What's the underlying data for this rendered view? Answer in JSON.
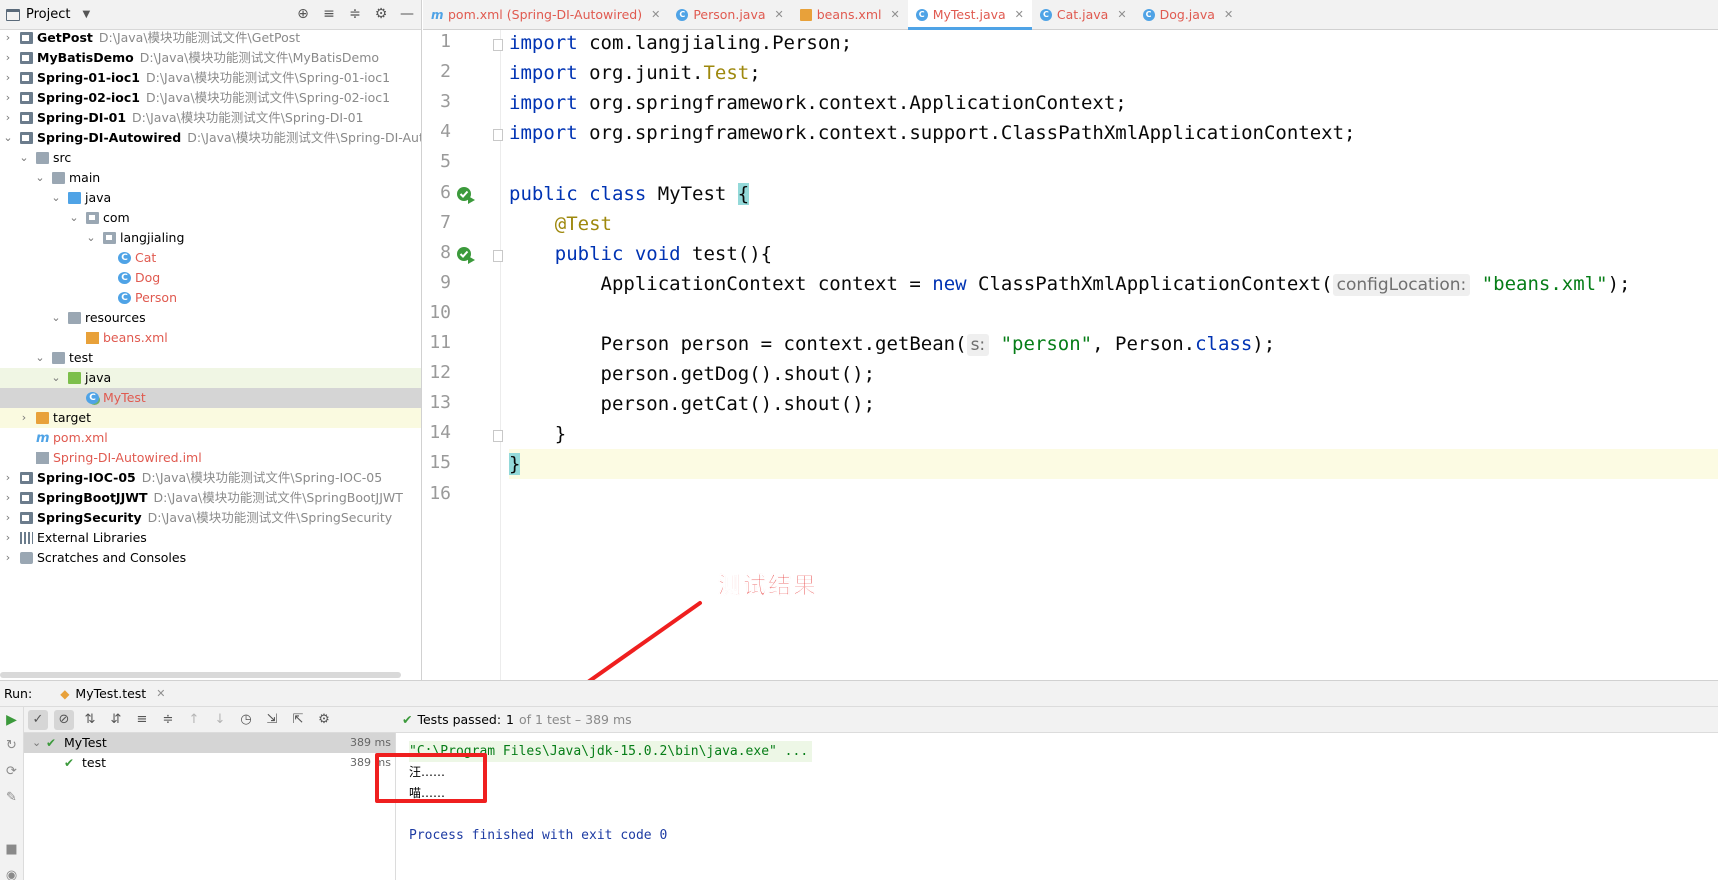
{
  "project_panel": {
    "title": "Project",
    "tree": [
      {
        "label": "GetPost",
        "path": "D:\\Java\\模块功能测试文件\\GetPost",
        "type": "module",
        "depth": 0,
        "expanded": false
      },
      {
        "label": "MyBatisDemo",
        "path": "D:\\Java\\模块功能测试文件\\MyBatisDemo",
        "type": "module",
        "depth": 0,
        "expanded": false
      },
      {
        "label": "Spring-01-ioc1",
        "path": "D:\\Java\\模块功能测试文件\\Spring-01-ioc1",
        "type": "module",
        "depth": 0,
        "expanded": false
      },
      {
        "label": "Spring-02-ioc1",
        "path": "D:\\Java\\模块功能测试文件\\Spring-02-ioc1",
        "type": "module",
        "depth": 0,
        "expanded": false
      },
      {
        "label": "Spring-DI-01",
        "path": "D:\\Java\\模块功能测试文件\\Spring-DI-01",
        "type": "module",
        "depth": 0,
        "expanded": false
      },
      {
        "label": "Spring-DI-Autowired",
        "path": "D:\\Java\\模块功能测试文件\\Spring-DI-Autowi",
        "type": "module",
        "depth": 0,
        "expanded": true
      },
      {
        "label": "src",
        "type": "folder",
        "depth": 1,
        "expanded": true
      },
      {
        "label": "main",
        "type": "folder",
        "depth": 2,
        "expanded": true
      },
      {
        "label": "java",
        "type": "folder-blue",
        "depth": 3,
        "expanded": true
      },
      {
        "label": "com",
        "type": "package",
        "depth": 4,
        "expanded": true
      },
      {
        "label": "langjialing",
        "type": "package",
        "depth": 5,
        "expanded": true
      },
      {
        "label": "Cat",
        "type": "class",
        "depth": 6
      },
      {
        "label": "Dog",
        "type": "class",
        "depth": 6
      },
      {
        "label": "Person",
        "type": "class",
        "depth": 6
      },
      {
        "label": "resources",
        "type": "folder-res",
        "depth": 3,
        "expanded": true
      },
      {
        "label": "beans.xml",
        "type": "xml",
        "depth": 4
      },
      {
        "label": "test",
        "type": "folder",
        "depth": 2,
        "expanded": true
      },
      {
        "label": "java",
        "type": "folder-green",
        "depth": 3,
        "expanded": true
      },
      {
        "label": "MyTest",
        "type": "test-class",
        "depth": 4
      },
      {
        "label": "target",
        "type": "folder-orange",
        "depth": 1,
        "expanded": false
      },
      {
        "label": "pom.xml",
        "type": "maven",
        "depth": 1
      },
      {
        "label": "Spring-DI-Autowired.iml",
        "type": "iml",
        "depth": 1
      },
      {
        "label": "Spring-IOC-05",
        "path": "D:\\Java\\模块功能测试文件\\Spring-IOC-05",
        "type": "module",
        "depth": 0,
        "expanded": false
      },
      {
        "label": "SpringBootJJWT",
        "path": "D:\\Java\\模块功能测试文件\\SpringBootJJWT",
        "type": "module",
        "depth": 0,
        "expanded": false
      },
      {
        "label": "SpringSecurity",
        "path": "D:\\Java\\模块功能测试文件\\SpringSecurity",
        "type": "module",
        "depth": 0,
        "expanded": false
      },
      {
        "label": "External Libraries",
        "type": "libraries",
        "depth": 0,
        "expanded": false
      },
      {
        "label": "Scratches and Consoles",
        "type": "scratches",
        "depth": 0,
        "expanded": false
      }
    ]
  },
  "editor_tabs": [
    {
      "label": "pom.xml (Spring-DI-Autowired)",
      "icon": "maven-icon",
      "active": false
    },
    {
      "label": "Person.java",
      "icon": "class-icon",
      "active": false
    },
    {
      "label": "beans.xml",
      "icon": "xml-icon",
      "active": false
    },
    {
      "label": "MyTest.java",
      "icon": "test-class-icon",
      "active": true
    },
    {
      "label": "Cat.java",
      "icon": "class-icon",
      "active": false
    },
    {
      "label": "Dog.java",
      "icon": "class-icon",
      "active": false
    }
  ],
  "editor": {
    "line_numbers": [
      "1",
      "2",
      "3",
      "4",
      "5",
      "6",
      "7",
      "8",
      "9",
      "10",
      "11",
      "12",
      "13",
      "14",
      "15",
      "16"
    ],
    "current_line": 15,
    "lines": [
      [
        {
          "t": "import",
          "c": "kw"
        },
        {
          "t": " com.langjialing.Person;"
        }
      ],
      [
        {
          "t": "import",
          "c": "kw"
        },
        {
          "t": " org.junit."
        },
        {
          "t": "Test",
          "c": "an"
        },
        {
          "t": ";"
        }
      ],
      [
        {
          "t": "import",
          "c": "kw"
        },
        {
          "t": " org.springframework.context.ApplicationContext;"
        }
      ],
      [
        {
          "t": "import",
          "c": "kw"
        },
        {
          "t": " org.springframework.context.support.ClassPathXmlApplicationContext;"
        }
      ],
      [],
      [
        {
          "t": "public class",
          "c": "kw"
        },
        {
          "t": " MyTest "
        },
        {
          "t": "{",
          "c": "brace"
        }
      ],
      [
        {
          "t": "    "
        },
        {
          "t": "@Test",
          "c": "an"
        }
      ],
      [
        {
          "t": "    "
        },
        {
          "t": "public void",
          "c": "kw"
        },
        {
          "t": " test(){"
        }
      ],
      [
        {
          "t": "        ApplicationContext context = "
        },
        {
          "t": "new",
          "c": "kw"
        },
        {
          "t": " ClassPathXmlApplicationContext("
        },
        {
          "t": "configLocation:",
          "c": "hint"
        },
        {
          "t": "\"beans.xml\"",
          "c": "str"
        },
        {
          "t": ");"
        }
      ],
      [],
      [
        {
          "t": "        Person person = context.getBean("
        },
        {
          "t": "s:",
          "c": "hint"
        },
        {
          "t": "\"person\"",
          "c": "str"
        },
        {
          "t": ", Person."
        },
        {
          "t": "class",
          "c": "kw"
        },
        {
          "t": ");"
        }
      ],
      [
        {
          "t": "        person.getDog().shout();"
        }
      ],
      [
        {
          "t": "        person.getCat().shout();"
        }
      ],
      [
        {
          "t": "    }"
        }
      ],
      [
        {
          "t": "}",
          "c": "brace"
        }
      ],
      []
    ]
  },
  "annotation": {
    "label": "测试结果"
  },
  "run_panel": {
    "run_label": "Run:",
    "tab_label": "MyTest.test",
    "status": {
      "prefix": "Tests passed:",
      "count": "1",
      "suffix": "of 1 test – 389 ms"
    },
    "tests": [
      {
        "name": "MyTest",
        "time": "389 ms",
        "expanded": true,
        "passed": true
      },
      {
        "name": "test",
        "time": "389 ms",
        "passed": true
      }
    ],
    "console": {
      "command": "\"C:\\Program Files\\Java\\jdk-15.0.2\\bin\\java.exe\" ...",
      "outputs": [
        "汪……",
        "喵……"
      ],
      "exit": "Process finished with exit code 0"
    }
  },
  "colors": {
    "keyword": "#0033b3",
    "annotation": "#9e880d",
    "string": "#067d17",
    "accent": "#4fa3e6",
    "annotation_red": "#ef1f1f",
    "pass_green": "#3c9a3c"
  }
}
